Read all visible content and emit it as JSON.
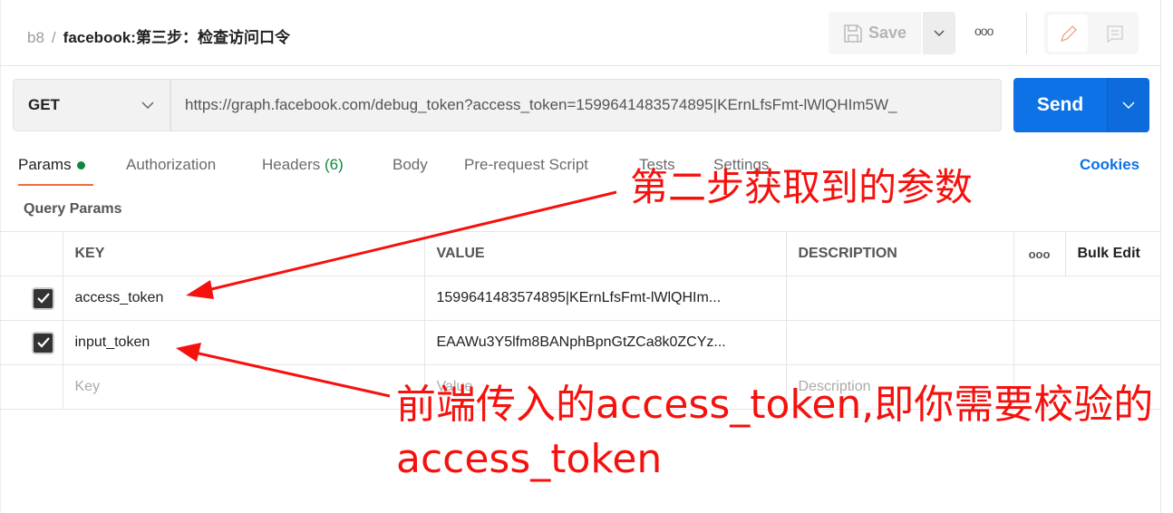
{
  "header": {
    "workspace": "b8",
    "separator": "/",
    "title": "facebook:第三步：检查访问口令",
    "save_label": "Save",
    "more_icon": "ellipsis-icon"
  },
  "request": {
    "method": "GET",
    "url": "https://graph.facebook.com/debug_token?access_token=1599641483574895|KErnLfsFmt-lWlQHIm5W_",
    "send_label": "Send"
  },
  "tabs": [
    {
      "label": "Params"
    },
    {
      "label": "Authorization"
    },
    {
      "label": "Headers",
      "count": "(6)"
    },
    {
      "label": "Body"
    },
    {
      "label": "Pre-request Script"
    },
    {
      "label": "Tests"
    },
    {
      "label": "Settings"
    }
  ],
  "cookies_label": "Cookies",
  "query_params_label": "Query Params",
  "table": {
    "headers": [
      "KEY",
      "VALUE",
      "DESCRIPTION"
    ],
    "bulk_edit": "Bulk Edit",
    "rows": [
      {
        "key": "access_token",
        "value": "1599641483574895|KErnLfsFmt-lWlQHIm...",
        "checked": true
      },
      {
        "key": "input_token",
        "value": "EAAWu3Y5lfm8BANphBpnGtZCa8k0ZCYz...",
        "checked": true
      }
    ],
    "placeholder": {
      "key": "Key",
      "value": "Value",
      "description": "Description"
    }
  },
  "annotations": {
    "note1": "第二步获取到的参数",
    "note2": "前端传入的access_token,即你需要校验的access_token",
    "color": "#f5110d"
  },
  "colors": {
    "accent": "#0d72e6",
    "tab_underline": "#f26b3a",
    "status_green": "#0a8a3a"
  }
}
